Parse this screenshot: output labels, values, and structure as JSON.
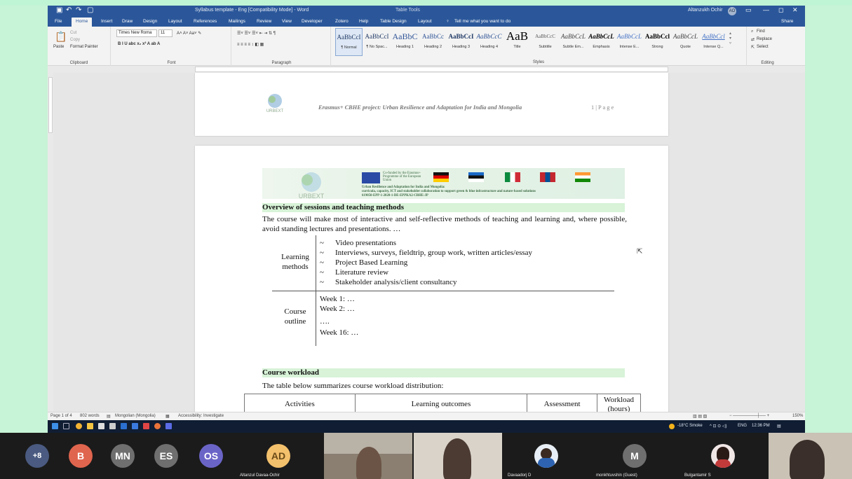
{
  "window": {
    "title": "Syllabus template - Eng [Compatibility Mode] - Word",
    "table_tools": "Table Tools",
    "user": "Altanzukh Ochir",
    "user_initials": "AO"
  },
  "tabs": [
    "File",
    "Home",
    "Insert",
    "Draw",
    "Design",
    "Layout",
    "References",
    "Mailings",
    "Review",
    "View",
    "Developer",
    "Zotero",
    "Help",
    "Table Design",
    "Layout"
  ],
  "tell_me": "Tell me what you want to do",
  "share": "Share",
  "clipboard": {
    "paste": "Paste",
    "cut": "Cut",
    "copy": "Copy",
    "format_painter": "Format Painter",
    "label": "Clipboard"
  },
  "font": {
    "name": "Times New Roma",
    "size": "11",
    "label": "Font"
  },
  "paragraph": {
    "label": "Paragraph"
  },
  "styles": {
    "label": "Styles",
    "items": [
      {
        "sample": "AaBbCcI",
        "name": "¶ Normal"
      },
      {
        "sample": "AaBbCcI",
        "name": "¶ No Spac..."
      },
      {
        "sample": "AaBbC",
        "name": "Heading 1"
      },
      {
        "sample": "AaBbCc",
        "name": "Heading 2"
      },
      {
        "sample": "AaBbCcI",
        "name": "Heading 3"
      },
      {
        "sample": "AaBbCcC",
        "name": "Heading 4"
      },
      {
        "sample": "AaB",
        "name": "Title"
      },
      {
        "sample": "AaBbCcC",
        "name": "Subtitle"
      },
      {
        "sample": "AaBbCcL",
        "name": "Subtle Em..."
      },
      {
        "sample": "AaBbCcL",
        "name": "Emphasis"
      },
      {
        "sample": "AaBbCcL",
        "name": "Intense E..."
      },
      {
        "sample": "AaBbCcl",
        "name": "Strong"
      },
      {
        "sample": "AaBbCcL",
        "name": "Quote"
      },
      {
        "sample": "AaBbCcl",
        "name": "Intense Q..."
      }
    ]
  },
  "editing": {
    "find": "Find",
    "replace": "Replace",
    "select": "Select",
    "label": "Editing"
  },
  "doc": {
    "header_text": "Erasmus+ CBHE project: Urban Resilience and Adaptation for India and Mongolia",
    "page_no": "1 | P a g e",
    "logo_text": "URBEXT",
    "banner_eu": "Co-funded by the Erasmus+ Programme of the European Union",
    "banner_title": "Urban Resilience and Adaptation for India and Mongolia:",
    "banner_sub": "curricula, capacity, ICT and stakeholder collaboration to support green & blue infrastructure and nature-based solutions",
    "banner_code": "619050-EPP-1-2020-1-DE-EPPKA2-CBHE-JP",
    "h1": "Overview of sessions and teaching methods",
    "p1": "The course will make most of interactive and self-reflective methods of teaching and learning and, where possible, avoid standing lectures and presentations. …",
    "lm_label": "Learning methods",
    "methods": [
      "Video presentations",
      "Interviews, surveys, fieldtrip, group work, written articles/essay",
      "Project Based Learning",
      "Literature review",
      "Stakeholder analysis/client consultancy"
    ],
    "bullet": "~",
    "co_label": "Course outline",
    "outline": [
      "Week 1: …",
      "Week 2: …",
      "….",
      "Week 16: …"
    ],
    "h2": "Course workload",
    "p2": "The table below summarizes course workload distribution:",
    "table_headers": [
      "Activities",
      "Learning outcomes",
      "Assessment",
      "Workload (hours)"
    ]
  },
  "status": {
    "page": "Page 1 of 4",
    "words": "802 words",
    "lang": "Mongolian (Mongolia)",
    "access": "Accessibility: Investigate",
    "zoom": "150%"
  },
  "taskbar": {
    "weather": "-18°C Smoke",
    "lang": "ENG",
    "time": "12:36 PM"
  },
  "participants": {
    "more": "+8",
    "circles": [
      {
        "initials": "B",
        "color": "#e0654e"
      },
      {
        "initials": "MN",
        "color": "#6f6f6f"
      },
      {
        "initials": "ES",
        "color": "#6f6f6f"
      },
      {
        "initials": "OS",
        "color": "#6b64c7"
      }
    ],
    "tiles": [
      {
        "initials": "AD",
        "name": "Altanzul Davaa-Ochir",
        "color": "#f3c06c"
      },
      {
        "name": "Davaadorj D"
      },
      {
        "initials": "M",
        "name": "monkhtuvshin (Guest)",
        "color": "#6f6f6f"
      },
      {
        "name": "Bulgantamir S"
      }
    ]
  }
}
